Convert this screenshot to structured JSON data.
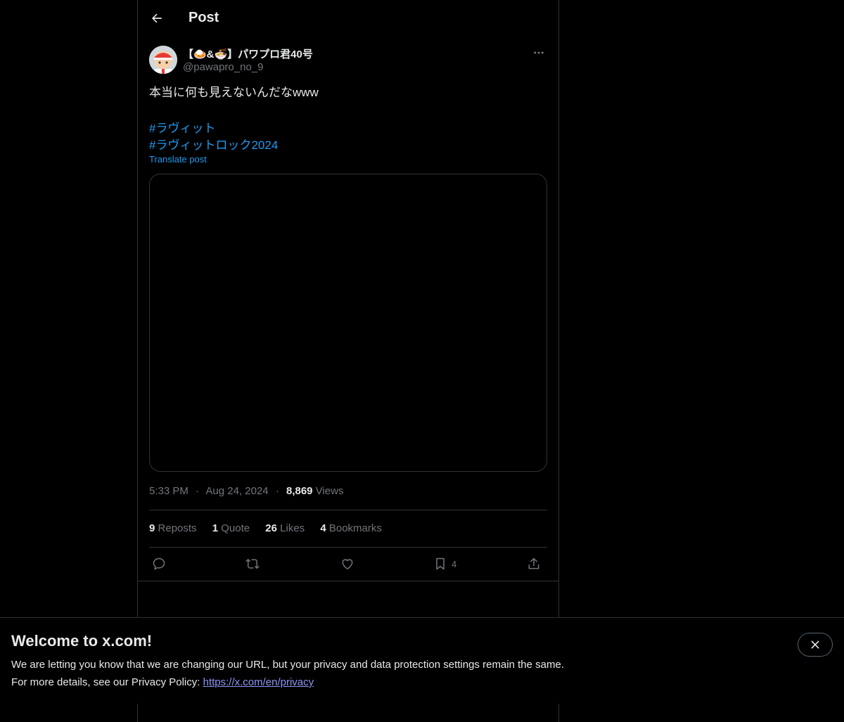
{
  "header": {
    "title": "Post"
  },
  "author": {
    "display_name": "【🍛&🍜】パワプロ君40号",
    "handle": "@pawapro_no_9"
  },
  "post": {
    "text": "本当に何も見えないんだなwww",
    "hashtags": [
      "#ラヴィット",
      "#ラヴィットロック2024"
    ],
    "translate_label": "Translate post"
  },
  "meta": {
    "time": "5:33 PM",
    "sep1": "·",
    "date": "Aug 24, 2024",
    "sep2": "·",
    "views_count": "8,869",
    "views_label": "Views"
  },
  "stats": {
    "reposts_count": "9",
    "reposts_label": "Reposts",
    "quote_count": "1",
    "quote_label": "Quote",
    "likes_count": "26",
    "likes_label": "Likes",
    "bookmarks_count": "4",
    "bookmarks_label": "Bookmarks"
  },
  "actions": {
    "bookmark_count": "4"
  },
  "banner": {
    "title": "Welcome to x.com!",
    "line1": "We are letting you know that we are changing our URL, but your privacy and data protection settings remain the same.",
    "line2_prefix": "For more details, see our Privacy Policy: ",
    "link": "https://x.com/en/privacy"
  },
  "icons": {
    "back": "arrow-left-icon",
    "more": "more-horizontal-icon",
    "reply": "reply-icon",
    "repost": "repost-icon",
    "like": "heart-icon",
    "bookmark": "bookmark-icon",
    "share": "share-icon",
    "close": "close-icon"
  },
  "colors": {
    "background": "#000000",
    "text": "#e7e9ea",
    "muted": "#71767b",
    "link": "#1d9bf0",
    "border": "#2f3336"
  }
}
